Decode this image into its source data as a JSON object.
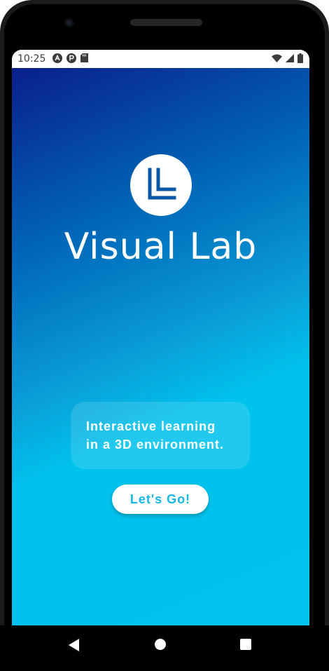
{
  "status_bar": {
    "time": "10:25",
    "left_icons": [
      "a-notification-icon",
      "p-notification-icon",
      "sd-card-icon"
    ],
    "right_icons": [
      "wifi-icon",
      "cell-signal-icon",
      "battery-icon"
    ]
  },
  "app": {
    "title": "Visual Lab",
    "logo_icon": "ll-logo-icon",
    "tagline": {
      "line1": "Interactive learning",
      "line2": "in a 3D environment."
    },
    "cta_label": "Let's Go!"
  },
  "colors": {
    "gradient_start": "#0a1f8a",
    "gradient_mid": "#0a9fd8",
    "gradient_end": "#00c3ee",
    "button_text": "#15b8e6"
  },
  "nav_bar": {
    "buttons": [
      "back-icon",
      "home-icon",
      "recents-icon"
    ]
  }
}
